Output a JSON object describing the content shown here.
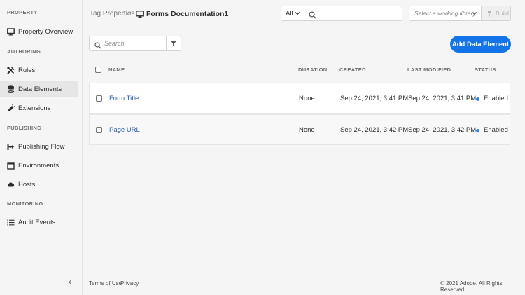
{
  "sidebar": {
    "sections": [
      {
        "label": "PROPERTY"
      },
      {
        "label": "AUTHORING"
      },
      {
        "label": "PUBLISHING"
      },
      {
        "label": "MONITORING"
      }
    ],
    "items": [
      {
        "label": "Property Overview",
        "icon": "monitor-icon"
      },
      {
        "label": "Rules",
        "icon": "tools-icon"
      },
      {
        "label": "Data Elements",
        "icon": "database-icon",
        "active": true
      },
      {
        "label": "Extensions",
        "icon": "plug-icon"
      },
      {
        "label": "Publishing Flow",
        "icon": "flow-icon"
      },
      {
        "label": "Environments",
        "icon": "window-icon"
      },
      {
        "label": "Hosts",
        "icon": "cloud-icon"
      },
      {
        "label": "Audit Events",
        "icon": "list-icon"
      }
    ],
    "collapse_glyph": "‹"
  },
  "header": {
    "breadcrumb_root": "Tag Properties",
    "breadcrumb_sep": "›",
    "title": "Forms Documentation1",
    "scope_value": "All",
    "library_placeholder": "Select a working library",
    "build_label": "Build"
  },
  "toolbar": {
    "search_placeholder": "Search",
    "add_label": "Add Data Element"
  },
  "table": {
    "headers": {
      "name": "NAME",
      "duration": "DURATION",
      "created": "CREATED",
      "modified": "LAST MODIFIED",
      "status": "STATUS"
    },
    "rows": [
      {
        "name": "Form Title",
        "duration": "None",
        "created": "Sep 24, 2021, 3:41 PM",
        "modified": "Sep 24, 2021, 3:41 PM",
        "status": "Enabled"
      },
      {
        "name": "Page URL",
        "duration": "None",
        "created": "Sep 24, 2021, 3:42 PM",
        "modified": "Sep 24, 2021, 3:42 PM",
        "status": "Enabled"
      }
    ]
  },
  "footer": {
    "terms": "Terms of Use",
    "privacy": "Privacy",
    "copyright": "© 2021 Adobe. All Rights Reserved."
  },
  "colors": {
    "accent": "#1473e6",
    "status_enabled": "#2680eb",
    "link": "#2c5ea8"
  }
}
